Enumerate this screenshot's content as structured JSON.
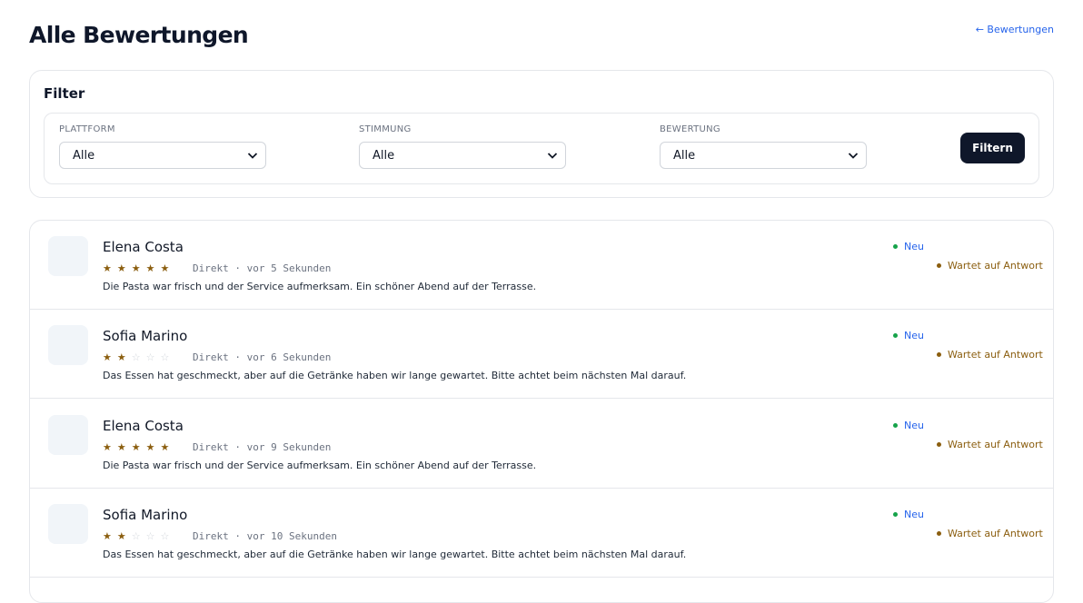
{
  "header": {
    "title": "Alle Bewertungen",
    "back_link": "← Bewertungen"
  },
  "filter": {
    "heading": "Filter",
    "fields": [
      {
        "label": "PLATTFORM",
        "value": "Alle"
      },
      {
        "label": "STIMMUNG",
        "value": "Alle"
      },
      {
        "label": "BEWERTUNG",
        "value": "Alle"
      }
    ],
    "button_label": "Filtern"
  },
  "reviews": [
    {
      "name": "Elena Costa",
      "rating": 5,
      "source": "Direkt",
      "time": "vor 5 Sekunden",
      "text": "Die Pasta war frisch und der Service aufmerksam. Ein schöner Abend auf der Terrasse.",
      "status_new": "Neu",
      "status_reply": "Wartet auf Antwort"
    },
    {
      "name": "Sofia Marino",
      "rating": 2,
      "source": "Direkt",
      "time": "vor 6 Sekunden",
      "text": "Das Essen hat geschmeckt, aber auf die Getränke haben wir lange gewartet. Bitte achtet beim nächsten Mal darauf.",
      "status_new": "Neu",
      "status_reply": "Wartet auf Antwort"
    },
    {
      "name": "Elena Costa",
      "rating": 5,
      "source": "Direkt",
      "time": "vor 9 Sekunden",
      "text": "Die Pasta war frisch und der Service aufmerksam. Ein schöner Abend auf der Terrasse.",
      "status_new": "Neu",
      "status_reply": "Wartet auf Antwort"
    },
    {
      "name": "Sofia Marino",
      "rating": 2,
      "source": "Direkt",
      "time": "vor 10 Sekunden",
      "text": "Das Essen hat geschmeckt, aber auf die Getränke haben wir lange gewartet. Bitte achtet beim nächsten Mal darauf.",
      "status_new": "Neu",
      "status_reply": "Wartet auf Antwort"
    }
  ],
  "colors": {
    "primary_button": "#0f172a",
    "link": "#2563eb",
    "star": "#8b5e0f",
    "status_new_dot": "#16a34a",
    "status_waiting": "#8b5e0f"
  },
  "icons": [
    "chevron-down-icon",
    "star-icon",
    "status-dot-icon"
  ]
}
